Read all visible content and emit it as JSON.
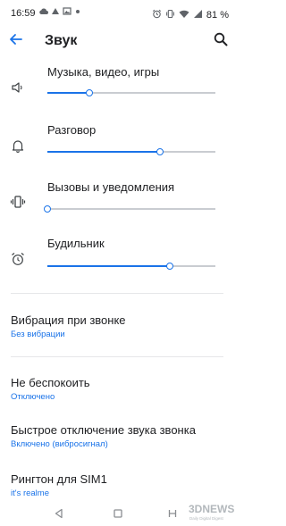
{
  "status_bar": {
    "time": "16:59",
    "left_icons": [
      "cloud-icon",
      "triangle-icon",
      "image-icon",
      "dot-icon"
    ],
    "right_icons": [
      "alarm-icon",
      "vibrate-icon",
      "wifi-icon",
      "signal-icon"
    ],
    "battery": "81 %"
  },
  "header": {
    "title": "Звук",
    "back_icon": "arrow-back-icon",
    "search_icon": "search-icon"
  },
  "volumes": [
    {
      "label": "Музыка, видео, игры",
      "icon": "speaker-icon",
      "level": 0.25
    },
    {
      "label": "Разговор",
      "icon": "bell-icon",
      "level": 0.67
    },
    {
      "label": "Вызовы и уведомления",
      "icon": "vibrate-icon",
      "level": 0.0
    },
    {
      "label": "Будильник",
      "icon": "alarm-icon",
      "level": 0.73
    }
  ],
  "settings": [
    {
      "title": "Вибрация при звонке",
      "subtitle": "Без вибрации"
    },
    {
      "title": "Не беспокоить",
      "subtitle": "Отключено"
    },
    {
      "title": "Быстрое отключение звука звонка",
      "subtitle": "Включено (вибросигнал)"
    },
    {
      "title": "Рингтон для SIM1",
      "subtitle": "it's realme"
    }
  ],
  "navigation": [
    "back-triangle-icon",
    "home-square-icon",
    "recents-icon"
  ],
  "colors": {
    "accent": "#1a73e8",
    "text": "#202124",
    "track": "#c9ccd1",
    "divider": "#e6e7e9"
  },
  "watermark": {
    "brand": "3DNEWS",
    "tagline": "Daily Digital Digest"
  }
}
